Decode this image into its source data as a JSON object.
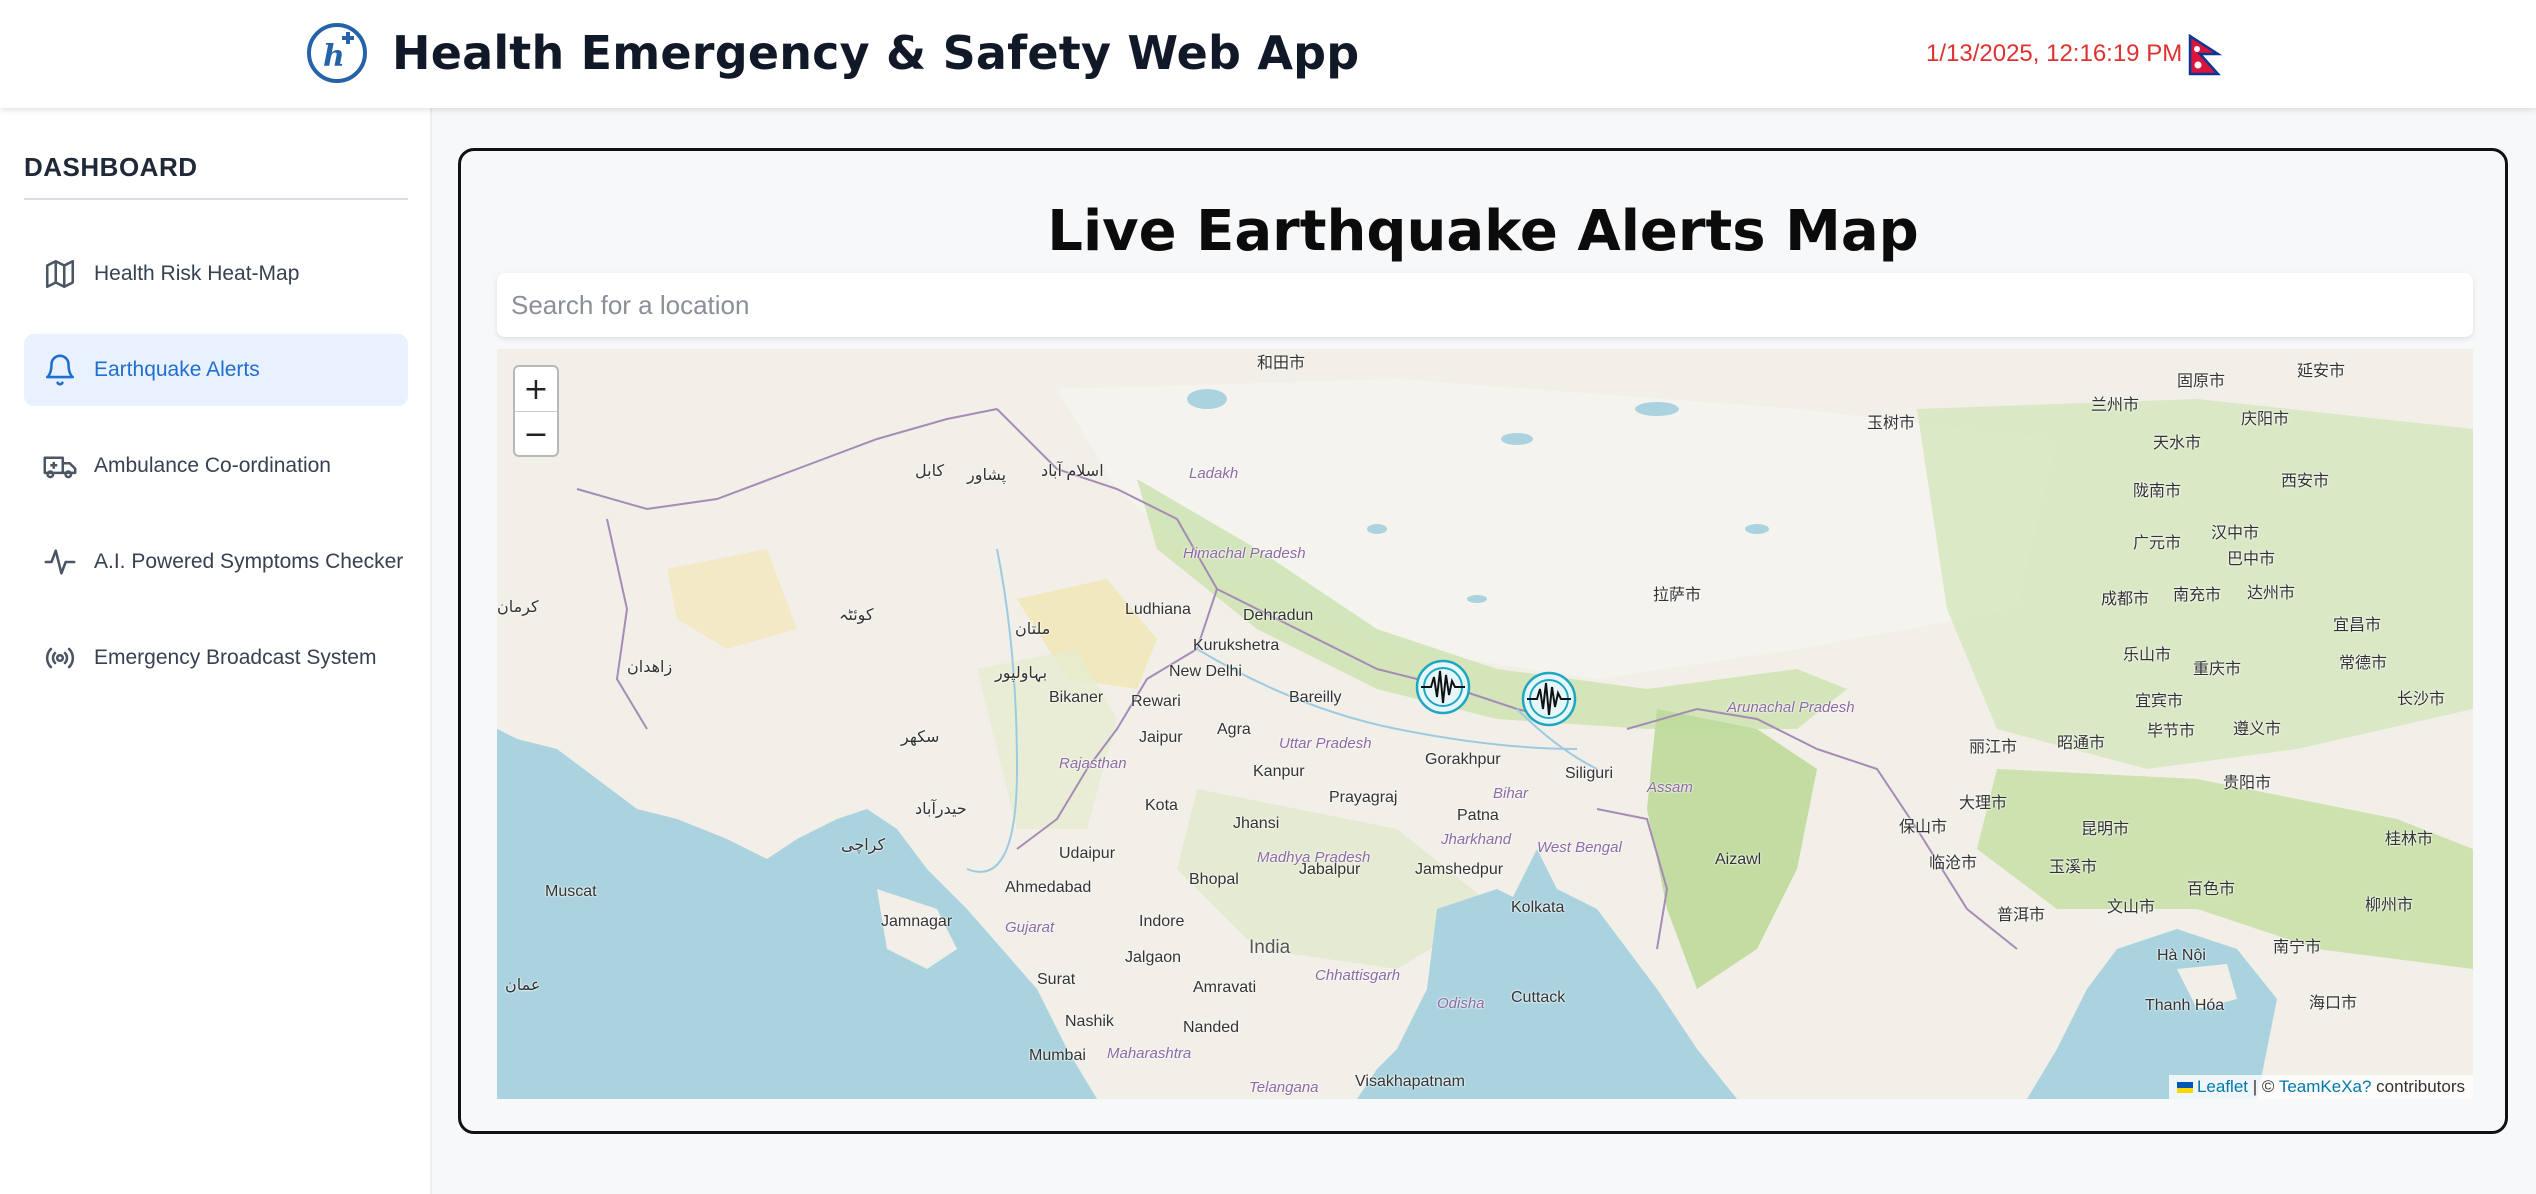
{
  "header": {
    "title": "Health Emergency & Safety Web App",
    "datetime": "1/13/2025, 12:16:19 PM",
    "flag_icon": "nepal-flag-icon",
    "logo_icon": "health-plus-logo-icon"
  },
  "sidebar": {
    "title": "DASHBOARD",
    "items": [
      {
        "label": "Health Risk Heat-Map",
        "icon": "map-icon",
        "active": false
      },
      {
        "label": "Earthquake Alerts",
        "icon": "bell-icon",
        "active": true
      },
      {
        "label": "Ambulance Co-ordination",
        "icon": "ambulance-icon",
        "active": false
      },
      {
        "label": "A.I. Powered Symptoms Checker",
        "icon": "activity-icon",
        "active": false
      },
      {
        "label": "Emergency Broadcast System",
        "icon": "broadcast-icon",
        "active": false
      }
    ]
  },
  "main": {
    "title": "Live Earthquake Alerts Map",
    "search_placeholder": "Search for a location",
    "zoom_in": "+",
    "zoom_out": "−",
    "attribution": {
      "leaflet": "Leaflet",
      "separator": " | © ",
      "osm": "TeamKeXa?",
      "suffix": " contributors"
    },
    "markers": [
      {
        "name": "earthquake-marker-1",
        "icon": "seismograph-icon"
      },
      {
        "name": "earthquake-marker-2",
        "icon": "seismograph-icon"
      }
    ],
    "map_labels": {
      "cities": [
        "Ludhiana",
        "Dehradun",
        "Kurukshetra",
        "New Delhi",
        "Bikaner",
        "Rewari",
        "Bareilly",
        "Jaipur",
        "Agra",
        "Kanpur",
        "Gorakhpur",
        "Siliguri",
        "Prayagraj",
        "Patna",
        "Kota",
        "Jhansi",
        "Udaipur",
        "Ahmedabad",
        "Bhopal",
        "Jabalpur",
        "Jamshedpur",
        "Kolkata",
        "Jamnagar",
        "Indore",
        "Jalgaon",
        "Surat",
        "Amravati",
        "Cuttack",
        "Nashik",
        "Nanded",
        "Mumbai",
        "Visakhapatnam",
        "Aizawl",
        "India",
        "Ladakh",
        "Himachal Pradesh",
        "Uttar Pradesh",
        "Rajasthan",
        "Madhya Pradesh",
        "Bihar",
        "Jharkhand",
        "West Bengal",
        "Gujarat",
        "Chhattisgarh",
        "Odisha",
        "Maharashtra",
        "Telangana",
        "Assam",
        "Arunachal Pradesh"
      ],
      "foreign": [
        "和田市",
        "兰州市",
        "固原市",
        "延安市",
        "天水市",
        "庆阳市",
        "西安市",
        "陇南市",
        "汉中市",
        "广元市",
        "巴中市",
        "成都市",
        "南充市",
        "达州市",
        "重庆市",
        "乐山市",
        "宜宾市",
        "昭通市",
        "毕节市",
        "遵义市",
        "贵阳市",
        "昆明市",
        "丽江市",
        "大理市",
        "保山市",
        "临沧市",
        "玉溪市",
        "普洱市",
        "文山市",
        "南宁市",
        "百色市",
        "柳州市",
        "桂林市",
        "长沙市",
        "宜昌市",
        "常德市",
        "拉萨市",
        "玉树市",
        "Muscat",
        "Thanh Hóa",
        "Hà Nội",
        "海口市",
        "کابل",
        "پشاور",
        "اسلام آباد",
        "کوئٹہ",
        "ملتان",
        "بہاولپور",
        "کراچی",
        "سکھر",
        "حیدرآباد",
        "زاهدان",
        "کرمان",
        "عمان"
      ]
    }
  },
  "colors": {
    "accent": "#1f6fd1",
    "active_bg": "#e8f1fd",
    "datetime": "#e03131",
    "water": "#aad3df",
    "land": "#f2efe9"
  }
}
